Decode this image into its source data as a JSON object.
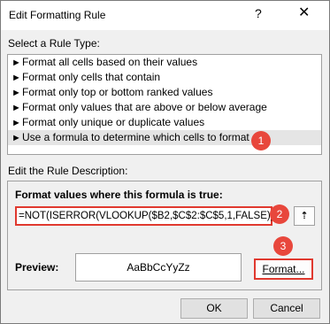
{
  "window": {
    "title": "Edit Formatting Rule",
    "help_label": "?",
    "close_label": "✕"
  },
  "rule_type": {
    "label": "Select a Rule Type:",
    "items": [
      "Format all cells based on their values",
      "Format only cells that contain",
      "Format only top or bottom ranked values",
      "Format only values that are above or below average",
      "Format only unique or duplicate values",
      "Use a formula to determine which cells to format"
    ],
    "selected_index": 5
  },
  "description": {
    "label": "Edit the Rule Description:",
    "formula_label": "Format values where this formula is true:",
    "formula_value": "=NOT(ISERROR(VLOOKUP($B2,$C$2:$C$5,1,FALSE)))",
    "collapse_label": "⇡",
    "preview_label": "Preview:",
    "preview_text": "AaBbCcYyZz",
    "format_button": "Format..."
  },
  "buttons": {
    "ok": "OK",
    "cancel": "Cancel"
  },
  "badges": [
    "1",
    "2",
    "3"
  ],
  "colors": {
    "highlight": "#e0392f",
    "badge": "#e8473c",
    "selected_row": "#e5e5e5"
  }
}
